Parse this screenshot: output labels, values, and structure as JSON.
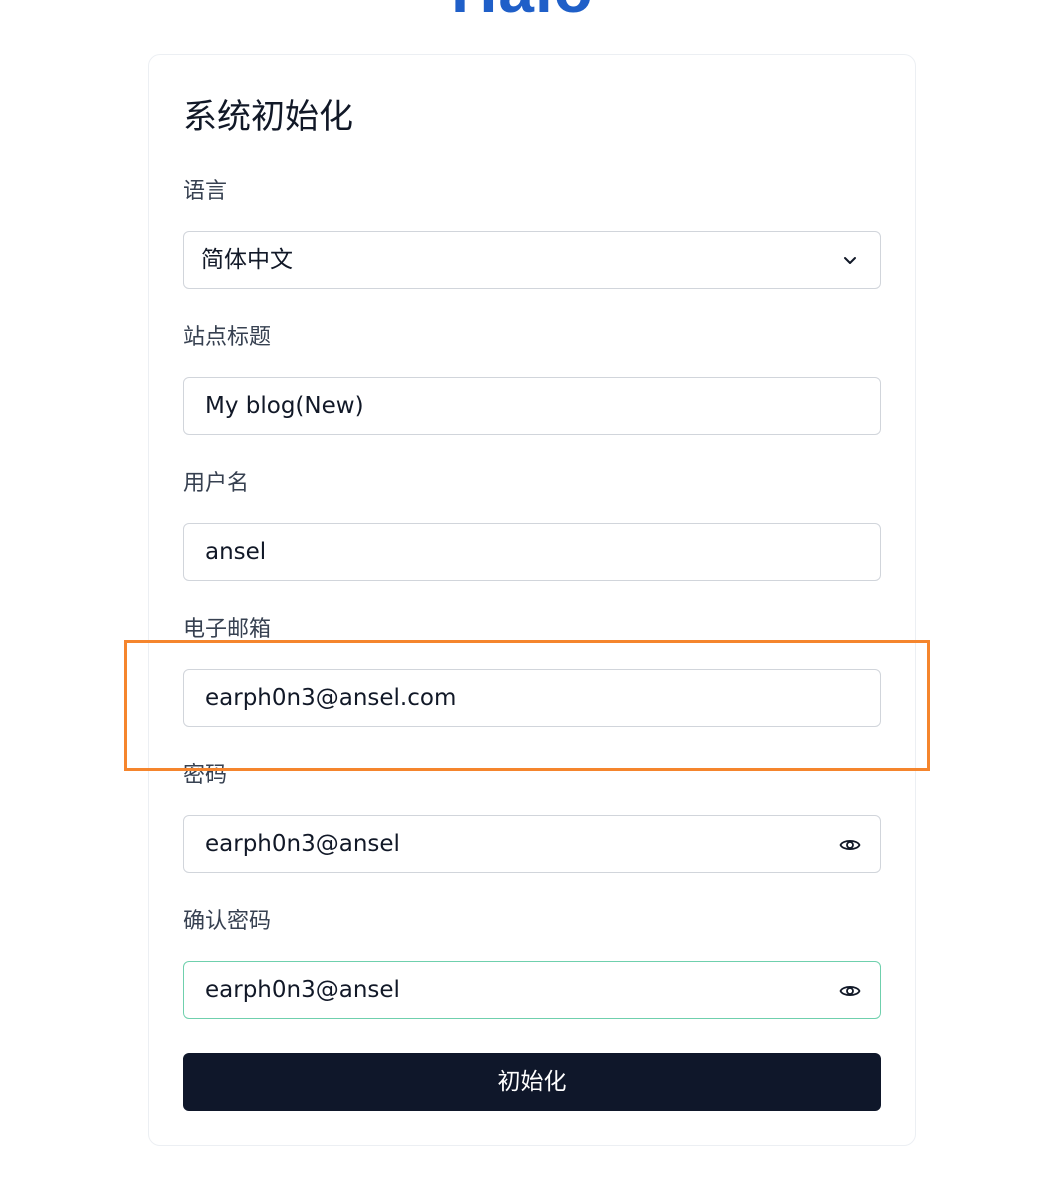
{
  "logo": {
    "text": "Halo",
    "color": "#1f5fc8"
  },
  "form": {
    "title": "系统初始化",
    "language": {
      "label": "语言",
      "value": "简体中文"
    },
    "site_title": {
      "label": "站点标题",
      "value": "My blog(New)"
    },
    "username": {
      "label": "用户名",
      "value": "ansel"
    },
    "email": {
      "label": "电子邮箱",
      "value": "earph0n3@ansel.com"
    },
    "password": {
      "label": "密码",
      "value": "earph0n3@ansel"
    },
    "confirm_password": {
      "label": "确认密码",
      "value": "earph0n3@ansel"
    },
    "submit_label": "初始化"
  },
  "colors": {
    "button_bg": "#0f172a",
    "focus_border": "#6fd0ad",
    "highlight_border": "#f5852d"
  },
  "icons": {
    "select": "chevron-down-icon",
    "password_toggle": "eye-icon"
  }
}
